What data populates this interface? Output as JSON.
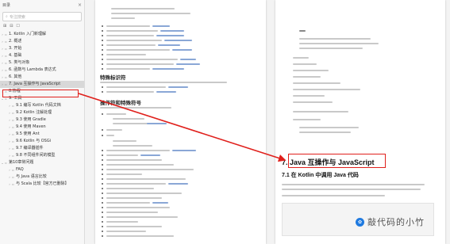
{
  "sidebar": {
    "title": "目录",
    "search_placeholder": "专注搜索",
    "items": [
      {
        "label": "1. Kotlin 入门新理解",
        "level": 1,
        "arrow": "›",
        "active": false
      },
      {
        "label": "2. 概述",
        "level": 1,
        "arrow": "›",
        "active": false
      },
      {
        "label": "3. 开始",
        "level": 1,
        "arrow": "›",
        "active": false
      },
      {
        "label": "4. 基础",
        "level": 1,
        "arrow": "›",
        "active": false
      },
      {
        "label": "5. 类与对象",
        "level": 1,
        "arrow": "›",
        "active": false
      },
      {
        "label": "6. 函数与 Lambda 表达式",
        "level": 1,
        "arrow": "›",
        "active": false
      },
      {
        "label": "6. 其他",
        "level": 1,
        "arrow": "›",
        "active": false
      },
      {
        "label": "7. Java 互操作与 JavaScript",
        "level": 1,
        "arrow": "›",
        "active": true
      },
      {
        "label": "8.协程",
        "level": 1,
        "arrow": "›",
        "active": false
      },
      {
        "label": "9. 工具",
        "level": 1,
        "arrow": "⌄",
        "active": false
      },
      {
        "label": "9.1 编写 Kotlin 代码文档",
        "level": 2,
        "arrow": "›",
        "active": false
      },
      {
        "label": "9.2 Kotlin 注解处理",
        "level": 2,
        "arrow": "›",
        "active": false
      },
      {
        "label": "9.3 使用 Gradle",
        "level": 2,
        "arrow": "›",
        "active": false
      },
      {
        "label": "9.4 使用 Maven",
        "level": 2,
        "arrow": "›",
        "active": false
      },
      {
        "label": "9.5 使用 Ant",
        "level": 2,
        "arrow": "›",
        "active": false
      },
      {
        "label": "9.6 Kotlin 与 OSGi",
        "level": 2,
        "arrow": "›",
        "active": false
      },
      {
        "label": "9.7 编译器插件",
        "level": 2,
        "arrow": "›",
        "active": false
      },
      {
        "label": "9.8 不同组件间的模型",
        "level": 2,
        "arrow": "›",
        "active": false
      },
      {
        "label": "第10章常问题",
        "level": 1,
        "arrow": "⌄",
        "active": false
      },
      {
        "label": "FAQ",
        "level": 2,
        "arrow": "›",
        "active": false
      },
      {
        "label": "与 Java 语言比较",
        "level": 2,
        "arrow": "›",
        "active": false
      },
      {
        "label": "与 Scala 比较【官方已删除】",
        "level": 2,
        "arrow": "›",
        "active": false
      }
    ]
  },
  "doc1": {
    "heading_a": "特殊标识符",
    "heading_b": "操作符和特殊符号"
  },
  "doc2": {
    "chapter_title": "7. Java 互操作与 JavaScript",
    "section_title": "7.1 在 Kotlin 中调用 Java 代码"
  },
  "watermark": {
    "text": "敲代码的小竹"
  },
  "colors": {
    "highlight": "#e0201c",
    "link": "#8aa7d6"
  }
}
